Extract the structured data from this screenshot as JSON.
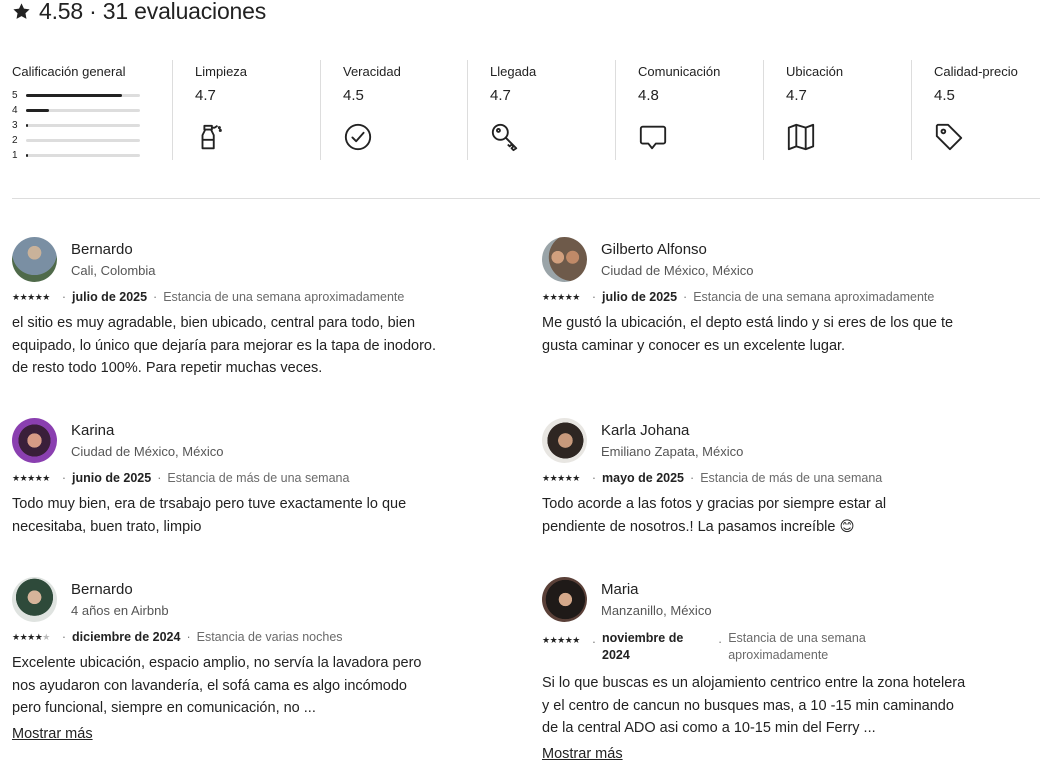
{
  "header": {
    "title": "4.58 · 31 evaluaciones"
  },
  "overall": {
    "label": "Calificación general",
    "bars": [
      {
        "label": "5",
        "fraction": 0.84
      },
      {
        "label": "4",
        "fraction": 0.2
      },
      {
        "label": "3",
        "fraction": 0.02
      },
      {
        "label": "2",
        "fraction": 0.0
      },
      {
        "label": "1",
        "fraction": 0.02
      }
    ]
  },
  "categories": [
    {
      "label": "Limpieza",
      "value": "4.7",
      "icon": "spray-bottle-icon"
    },
    {
      "label": "Veracidad",
      "value": "4.5",
      "icon": "check-circle-icon"
    },
    {
      "label": "Llegada",
      "value": "4.7",
      "icon": "key-icon"
    },
    {
      "label": "Comunicación",
      "value": "4.8",
      "icon": "speech-bubble-icon"
    },
    {
      "label": "Ubicación",
      "value": "4.7",
      "icon": "map-icon"
    },
    {
      "label": "Calidad-precio",
      "value": "4.5",
      "icon": "price-tag-icon"
    }
  ],
  "reviews": [
    {
      "name": "Bernardo",
      "location": "Cali, Colombia",
      "stars": 5,
      "date": "julio de 2025",
      "stay": "Estancia de una semana aproximadamente",
      "text": "el sitio es muy agradable, bien ubicado, central para todo, bien equipado, lo único que dejaría para mejorar es la tapa de inodoro. de resto todo 100%. Para repetir muchas veces.",
      "more": "",
      "avatar_color": "#7a8fa3"
    },
    {
      "name": "Gilberto Alfonso",
      "location": "Ciudad de México, México",
      "stars": 5,
      "date": "julio de 2025",
      "stay": "Estancia de una semana aproximadamente",
      "text": "Me gustó la ubicación, el depto está lindo y si eres de los que te gusta caminar y conocer es un excelente lugar.",
      "more": "",
      "avatar_color": "#8b6f5c"
    },
    {
      "name": "Karina",
      "location": "Ciudad de México, México",
      "stars": 5,
      "date": "junio de 2025",
      "stay": "Estancia de más de una semana",
      "text": "Todo muy bien, era de trsabajo pero tuve exactamente lo que necesitaba, buen trato, limpio",
      "more": "",
      "avatar_color": "#6e3a8c"
    },
    {
      "name": "Karla Johana",
      "location": "Emiliano Zapata, México",
      "stars": 5,
      "date": "mayo de 2025",
      "stay": "Estancia de más de una semana",
      "text": "Todo acorde a las fotos y gracias por siempre estar al pendiente de nosotros.! La pasamos increíble 😊",
      "more": "",
      "avatar_color": "#5b4a3e"
    },
    {
      "name": "Bernardo",
      "location": "4 años en Airbnb",
      "stars": 4,
      "date": "diciembre de 2024",
      "stay": "Estancia de varias noches",
      "text": "Excelente ubicación, espacio amplio, no servía la lavadora pero nos ayudaron con lavandería, el sofá cama es algo incómodo pero funcional, siempre en comunicación, no ...",
      "more": "Mostrar más",
      "avatar_color": "#3f5a4a"
    },
    {
      "name": "Maria",
      "location": "Manzanillo, México",
      "stars": 5,
      "date": "noviembre de 2024",
      "stay": "Estancia de una semana aproximadamente",
      "text": "Si lo que buscas es un alojamiento centrico entre la zona hotelera y el centro  de cancun  no busques mas, a 10 -15 min caminando de la central  ADO asi como a 10-15 min del Ferry ...",
      "more": "Mostrar más",
      "avatar_color": "#4a3530"
    }
  ]
}
